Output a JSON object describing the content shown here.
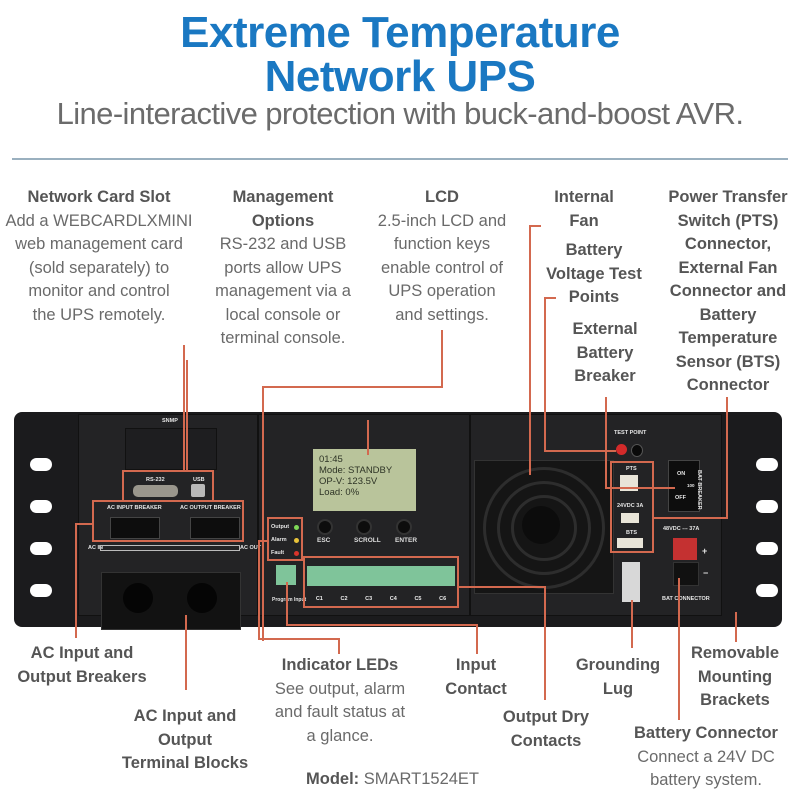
{
  "header": {
    "title_line1": "Extreme Temperature",
    "title_line2": "Network UPS",
    "subtitle": "Line-interactive protection with buck-and-boost AVR."
  },
  "callouts": {
    "network_card": {
      "title": "Network Card Slot",
      "lines": [
        "Add a WEBCARDLXMINI",
        "web management card",
        "(sold separately) to",
        "monitor and control",
        "the UPS remotely."
      ]
    },
    "management": {
      "title_lines": [
        "Management",
        "Options"
      ],
      "lines": [
        "RS-232 and USB",
        "ports allow UPS",
        "management via a",
        "local console or",
        "terminal console."
      ]
    },
    "lcd": {
      "title": "LCD",
      "lines": [
        "2.5-inch LCD and",
        "function keys",
        "enable control of",
        "UPS operation",
        "and settings."
      ]
    },
    "internal_fan": {
      "title_lines": [
        "Internal",
        "Fan"
      ]
    },
    "battery_test": {
      "title_lines": [
        "Battery",
        "Voltage Test",
        "Points"
      ]
    },
    "ext_breaker": {
      "title_lines": [
        "External",
        "Battery",
        "Breaker"
      ]
    },
    "pts": {
      "title_lines": [
        "Power Transfer",
        "Switch (PTS)",
        "Connector,",
        "External Fan",
        "Connector and",
        "Battery",
        "Temperature",
        "Sensor (BTS)",
        "Connector"
      ]
    },
    "ac_breakers": {
      "title_lines": [
        "AC Input and",
        "Output Breakers"
      ]
    },
    "ac_terminals": {
      "title_lines": [
        "AC Input and",
        "Output",
        "Terminal Blocks"
      ]
    },
    "indicator_leds": {
      "title": "Indicator LEDs",
      "lines": [
        "See output, alarm",
        "and fault status at",
        "a glance."
      ]
    },
    "input_contact": {
      "title_lines": [
        "Input",
        "Contact"
      ]
    },
    "output_dry": {
      "title_lines": [
        "Output Dry",
        "Contacts"
      ]
    },
    "grounding": {
      "title_lines": [
        "Grounding",
        "Lug"
      ]
    },
    "brackets": {
      "title_lines": [
        "Removable",
        "Mounting",
        "Brackets"
      ]
    },
    "battery_connector": {
      "title": "Battery Connector",
      "lines": [
        "Connect a 24V DC",
        "battery system."
      ]
    }
  },
  "model": {
    "label": "Model:",
    "value": "SMART1524ET"
  },
  "device": {
    "snmp": "SNMP",
    "rs232": "RS-232",
    "usb": "USB",
    "ac_input_breaker": "AC INPUT BREAKER",
    "ac_output_breaker": "AC OUTPUT BREAKER",
    "ac_in": "AC IN",
    "ac_out": "AC OUT",
    "lcd_lines": [
      "01:45",
      "Mode: STANDBY",
      "OP-V: 123.5V",
      "Load: 0%"
    ],
    "keys": [
      "ESC",
      "SCROLL",
      "ENTER"
    ],
    "leds": [
      {
        "label": "Output",
        "color": "#7ed957"
      },
      {
        "label": "Alarm",
        "color": "#e8c33a"
      },
      {
        "label": "Fault",
        "color": "#d9342b"
      }
    ],
    "program_input": "Program Input",
    "dry_contact_groups": [
      "C1",
      "C2",
      "C3",
      "C4",
      "C5",
      "C6"
    ],
    "test_point": "TEST POINT",
    "pts": "PTS",
    "fan_connector": "24VDC 3A",
    "bts": "BTS",
    "bat_breaker": "BAT BREAKER",
    "breaker_on": "ON",
    "breaker_off": "OFF",
    "breaker_rating": "100",
    "bat_rating": "48VDC --- 37A",
    "bat_connector": "BAT CONNECTOR"
  },
  "colors": {
    "title_blue": "#1a78c2",
    "callout_line": "#d3694f",
    "text_gray": "#5a5a5a"
  }
}
